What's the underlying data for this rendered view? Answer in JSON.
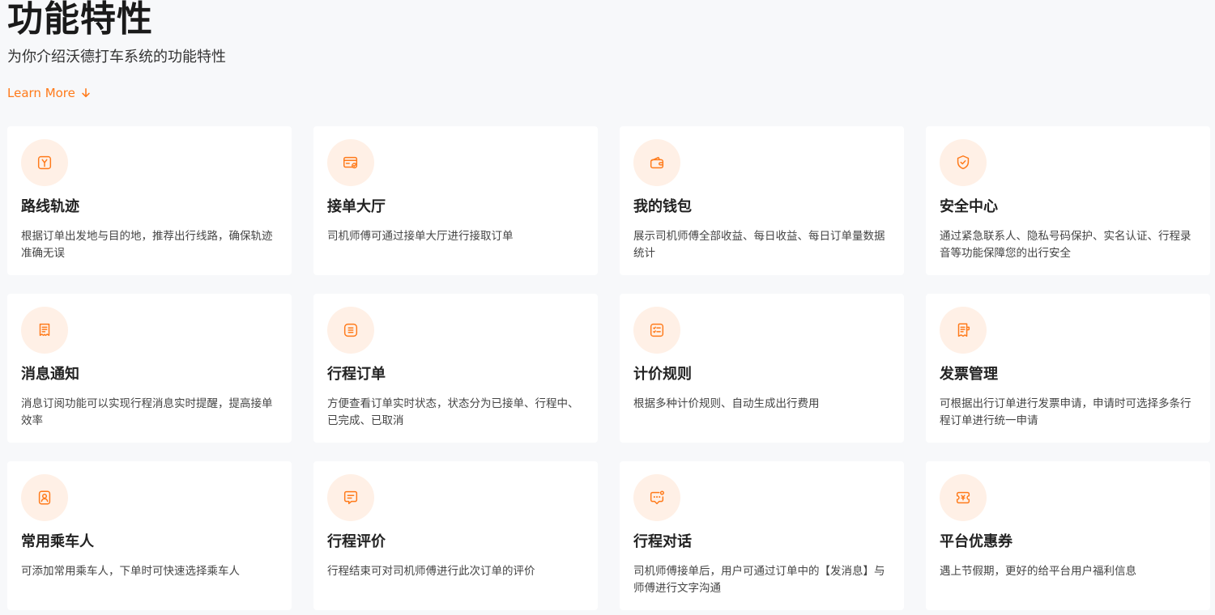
{
  "header": {
    "title": "功能特性",
    "subtitle": "为你介绍沃德打车系统的功能特性",
    "learn_more": "Learn More"
  },
  "accent_color": "#ff7a1a",
  "features": [
    {
      "icon": "route-icon",
      "title": "路线轨迹",
      "desc": "根据订单出发地与目的地，推荐出行线路，确保轨迹准确无误"
    },
    {
      "icon": "order-hall-icon",
      "title": "接单大厅",
      "desc": "司机师傅可通过接单大厅进行接取订单"
    },
    {
      "icon": "wallet-icon",
      "title": "我的钱包",
      "desc": "展示司机师傅全部收益、每日收益、每日订单量数据统计"
    },
    {
      "icon": "shield-icon",
      "title": "安全中心",
      "desc": "通过紧急联系人、隐私号码保护、实名认证、行程录音等功能保障您的出行安全"
    },
    {
      "icon": "notification-icon",
      "title": "消息通知",
      "desc": "消息订阅功能可以实现行程消息实时提醒，提高接单效率"
    },
    {
      "icon": "trip-order-icon",
      "title": "行程订单",
      "desc": "方便查看订单实时状态，状态分为已接单、行程中、已完成、已取消"
    },
    {
      "icon": "pricing-icon",
      "title": "计价规则",
      "desc": "根据多种计价规则、自动生成出行费用"
    },
    {
      "icon": "invoice-icon",
      "title": "发票管理",
      "desc": "可根据出行订单进行发票申请，申请时可选择多条行程订单进行统一申请"
    },
    {
      "icon": "passenger-icon",
      "title": "常用乘车人",
      "desc": "可添加常用乘车人，下单时可快速选择乘车人"
    },
    {
      "icon": "review-icon",
      "title": "行程评价",
      "desc": "行程结束可对司机师傅进行此次订单的评价"
    },
    {
      "icon": "chat-icon",
      "title": "行程对话",
      "desc": "司机师傅接单后，用户可通过订单中的【发消息】与师傅进行文字沟通"
    },
    {
      "icon": "coupon-icon",
      "title": "平台优惠券",
      "desc": "遇上节假期，更好的给平台用户福利信息"
    }
  ]
}
